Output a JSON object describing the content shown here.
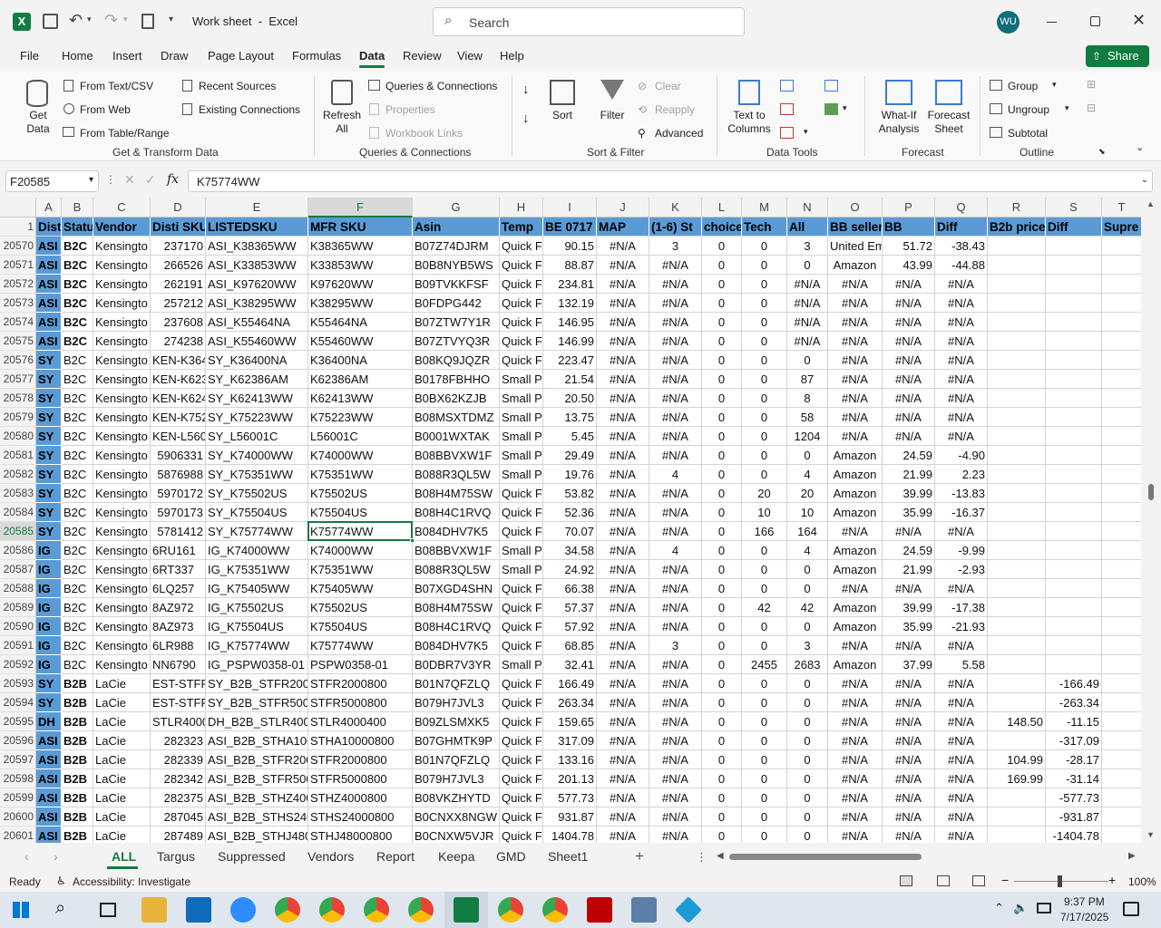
{
  "titlebar": {
    "doc_title": "Work sheet  -  Excel",
    "search_placeholder": "Search",
    "user_initials": "WU"
  },
  "tabs": [
    "File",
    "Home",
    "Insert",
    "Draw",
    "Page Layout",
    "Formulas",
    "Data",
    "Review",
    "View",
    "Help"
  ],
  "active_tab": "Data",
  "share_label": "Share",
  "ribbon": {
    "get_data": "Get Data",
    "from_text_csv": "From Text/CSV",
    "from_web": "From Web",
    "from_table": "From Table/Range",
    "recent_sources": "Recent Sources",
    "existing_connections": "Existing Connections",
    "group_get_transform": "Get & Transform Data",
    "refresh_all": "Refresh All",
    "queries_connections": "Queries & Connections",
    "properties": "Properties",
    "workbook_links": "Workbook Links",
    "group_queries": "Queries & Connections",
    "sort": "Sort",
    "filter": "Filter",
    "clear": "Clear",
    "reapply": "Reapply",
    "advanced": "Advanced",
    "group_sort_filter": "Sort & Filter",
    "text_to_columns": "Text to Columns",
    "group_data_tools": "Data Tools",
    "what_if": "What-If Analysis",
    "forecast_sheet": "Forecast Sheet",
    "group_forecast": "Forecast",
    "group": "Group",
    "ungroup": "Ungroup",
    "subtotal": "Subtotal",
    "group_outline": "Outline"
  },
  "formula_bar": {
    "name_box": "F20585",
    "fx": "fx",
    "value": "K75774WW"
  },
  "columns": [
    "A",
    "B",
    "C",
    "D",
    "E",
    "F",
    "G",
    "H",
    "I",
    "J",
    "K",
    "L",
    "M",
    "N",
    "O",
    "P",
    "Q",
    "R",
    "S",
    "T"
  ],
  "header_row_num": "1",
  "headers": [
    "Dist",
    "Statu",
    "Vendor",
    "Disti SKU",
    "LISTEDSKU",
    "MFR SKU",
    "Asin",
    "Temp",
    "BE 0717",
    "MAP",
    "(1-6) St",
    "choice",
    "Tech",
    "All",
    "BB sellers",
    "BB",
    "Diff",
    "B2b price",
    "Diff",
    "Supre"
  ],
  "rows": [
    {
      "n": "20570",
      "c": [
        "ASI",
        "B2C",
        "Kensingto",
        "237170",
        "ASI_K38365WW",
        "K38365WW",
        "B07Z74DJRM",
        "Quick F",
        "90.15",
        "#N/A",
        "3",
        "0",
        "0",
        "3",
        "United Em",
        "51.72",
        "-38.43",
        "",
        ""
      ]
    },
    {
      "n": "20571",
      "c": [
        "ASI",
        "B2C",
        "Kensingto",
        "266526",
        "ASI_K33853WW",
        "K33853WW",
        "B0B8NYB5WS",
        "Quick F",
        "88.87",
        "#N/A",
        "#N/A",
        "0",
        "0",
        "0",
        "Amazon",
        "43.99",
        "-44.88",
        "",
        ""
      ]
    },
    {
      "n": "20572",
      "c": [
        "ASI",
        "B2C",
        "Kensingto",
        "262191",
        "ASI_K97620WW",
        "K97620WW",
        "B09TVKKFSF",
        "Quick F",
        "234.81",
        "#N/A",
        "#N/A",
        "0",
        "0",
        "#N/A",
        "#N/A",
        "#N/A",
        "#N/A",
        "",
        ""
      ]
    },
    {
      "n": "20573",
      "c": [
        "ASI",
        "B2C",
        "Kensingto",
        "257212",
        "ASI_K38295WW",
        "K38295WW",
        "B0FDPG442",
        "Quick F",
        "132.19",
        "#N/A",
        "#N/A",
        "0",
        "0",
        "#N/A",
        "#N/A",
        "#N/A",
        "#N/A",
        "",
        ""
      ]
    },
    {
      "n": "20574",
      "c": [
        "ASI",
        "B2C",
        "Kensingto",
        "237608",
        "ASI_K55464NA",
        "K55464NA",
        "B07ZTW7Y1R",
        "Quick F",
        "146.95",
        "#N/A",
        "#N/A",
        "0",
        "0",
        "#N/A",
        "#N/A",
        "#N/A",
        "#N/A",
        "",
        ""
      ]
    },
    {
      "n": "20575",
      "c": [
        "ASI",
        "B2C",
        "Kensingto",
        "274238",
        "ASI_K55460WW",
        "K55460WW",
        "B07ZTVYQ3R",
        "Quick F",
        "146.99",
        "#N/A",
        "#N/A",
        "0",
        "0",
        "#N/A",
        "#N/A",
        "#N/A",
        "#N/A",
        "",
        ""
      ]
    },
    {
      "n": "20576",
      "c": [
        "SY",
        "B2C",
        "Kensingto",
        "KEN-K364",
        "SY_K36400NA",
        "K36400NA",
        "B08KQ9JQZR",
        "Quick F",
        "223.47",
        "#N/A",
        "#N/A",
        "0",
        "0",
        "0",
        "#N/A",
        "#N/A",
        "#N/A",
        "",
        ""
      ]
    },
    {
      "n": "20577",
      "c": [
        "SY",
        "B2C",
        "Kensingto",
        "KEN-K623",
        "SY_K62386AM",
        "K62386AM",
        "B0178FBHHO",
        "Small P",
        "21.54",
        "#N/A",
        "#N/A",
        "0",
        "0",
        "87",
        "#N/A",
        "#N/A",
        "#N/A",
        "",
        ""
      ]
    },
    {
      "n": "20578",
      "c": [
        "SY",
        "B2C",
        "Kensingto",
        "KEN-K624",
        "SY_K62413WW",
        "K62413WW",
        "B0BX62KZJB",
        "Small P",
        "20.50",
        "#N/A",
        "#N/A",
        "0",
        "0",
        "8",
        "#N/A",
        "#N/A",
        "#N/A",
        "",
        ""
      ]
    },
    {
      "n": "20579",
      "c": [
        "SY",
        "B2C",
        "Kensingto",
        "KEN-K752",
        "SY_K75223WW",
        "K75223WW",
        "B08MSXTDMZ",
        "Small P",
        "13.75",
        "#N/A",
        "#N/A",
        "0",
        "0",
        "58",
        "#N/A",
        "#N/A",
        "#N/A",
        "",
        ""
      ]
    },
    {
      "n": "20580",
      "c": [
        "SY",
        "B2C",
        "Kensingto",
        "KEN-L5600",
        "SY_L56001C",
        "L56001C",
        "B0001WXTAK",
        "Small P",
        "5.45",
        "#N/A",
        "#N/A",
        "0",
        "0",
        "1204",
        "#N/A",
        "#N/A",
        "#N/A",
        "",
        ""
      ]
    },
    {
      "n": "20581",
      "c": [
        "SY",
        "B2C",
        "Kensingto",
        "5906331",
        "SY_K74000WW",
        "K74000WW",
        "B08BBVXW1F",
        "Small P",
        "29.49",
        "#N/A",
        "#N/A",
        "0",
        "0",
        "0",
        "Amazon",
        "24.59",
        "-4.90",
        "",
        ""
      ]
    },
    {
      "n": "20582",
      "c": [
        "SY",
        "B2C",
        "Kensingto",
        "5876988",
        "SY_K75351WW",
        "K75351WW",
        "B088R3QL5W",
        "Small P",
        "19.76",
        "#N/A",
        "4",
        "0",
        "0",
        "4",
        "Amazon",
        "21.99",
        "2.23",
        "",
        ""
      ]
    },
    {
      "n": "20583",
      "c": [
        "SY",
        "B2C",
        "Kensingto",
        "5970172",
        "SY_K75502US",
        "K75502US",
        "B08H4M75SW",
        "Quick F",
        "53.82",
        "#N/A",
        "#N/A",
        "0",
        "20",
        "20",
        "Amazon",
        "39.99",
        "-13.83",
        "",
        ""
      ]
    },
    {
      "n": "20584",
      "c": [
        "SY",
        "B2C",
        "Kensingto",
        "5970173",
        "SY_K75504US",
        "K75504US",
        "B08H4C1RVQ",
        "Quick F",
        "52.36",
        "#N/A",
        "#N/A",
        "0",
        "10",
        "10",
        "Amazon",
        "35.99",
        "-16.37",
        "",
        ""
      ]
    },
    {
      "n": "20585",
      "c": [
        "SY",
        "B2C",
        "Kensingto",
        "5781412",
        "SY_K75774WW",
        "K75774WW",
        "B084DHV7K5",
        "Quick F",
        "70.07",
        "#N/A",
        "#N/A",
        "0",
        "166",
        "164",
        "#N/A",
        "#N/A",
        "#N/A",
        "",
        ""
      ]
    },
    {
      "n": "20586",
      "c": [
        "IG",
        "B2C",
        "Kensingto",
        "6RU161",
        "IG_K74000WW",
        "K74000WW",
        "B08BBVXW1F",
        "Small P",
        "34.58",
        "#N/A",
        "4",
        "0",
        "0",
        "4",
        "Amazon",
        "24.59",
        "-9.99",
        "",
        ""
      ]
    },
    {
      "n": "20587",
      "c": [
        "IG",
        "B2C",
        "Kensingto",
        "6RT337",
        "IG_K75351WW",
        "K75351WW",
        "B088R3QL5W",
        "Small P",
        "24.92",
        "#N/A",
        "#N/A",
        "0",
        "0",
        "0",
        "Amazon",
        "21.99",
        "-2.93",
        "",
        ""
      ]
    },
    {
      "n": "20588",
      "c": [
        "IG",
        "B2C",
        "Kensingto",
        "6LQ257",
        "IG_K75405WW",
        "K75405WW",
        "B07XGD4SHN",
        "Quick F",
        "66.38",
        "#N/A",
        "#N/A",
        "0",
        "0",
        "0",
        "#N/A",
        "#N/A",
        "#N/A",
        "",
        ""
      ]
    },
    {
      "n": "20589",
      "c": [
        "IG",
        "B2C",
        "Kensingto",
        "8AZ972",
        "IG_K75502US",
        "K75502US",
        "B08H4M75SW",
        "Quick F",
        "57.37",
        "#N/A",
        "#N/A",
        "0",
        "42",
        "42",
        "Amazon",
        "39.99",
        "-17.38",
        "",
        ""
      ]
    },
    {
      "n": "20590",
      "c": [
        "IG",
        "B2C",
        "Kensingto",
        "8AZ973",
        "IG_K75504US",
        "K75504US",
        "B08H4C1RVQ",
        "Quick F",
        "57.92",
        "#N/A",
        "#N/A",
        "0",
        "0",
        "0",
        "Amazon",
        "35.99",
        "-21.93",
        "",
        ""
      ]
    },
    {
      "n": "20591",
      "c": [
        "IG",
        "B2C",
        "Kensingto",
        "6LR988",
        "IG_K75774WW",
        "K75774WW",
        "B084DHV7K5",
        "Quick F",
        "68.85",
        "#N/A",
        "3",
        "0",
        "0",
        "3",
        "#N/A",
        "#N/A",
        "#N/A",
        "",
        ""
      ]
    },
    {
      "n": "20592",
      "c": [
        "IG",
        "B2C",
        "Kensingto",
        "NN6790",
        "IG_PSPW0358-01",
        "PSPW0358-01",
        "B0DBR7V3YR",
        "Small P",
        "32.41",
        "#N/A",
        "#N/A",
        "0",
        "2455",
        "2683",
        "Amazon",
        "37.99",
        "5.58",
        "",
        ""
      ]
    },
    {
      "n": "20593",
      "c": [
        "SY",
        "B2B",
        "LaCie",
        "EST-STFR2",
        "SY_B2B_STFR2000800",
        "STFR2000800",
        "B01N7QFZLQ",
        "Quick F",
        "166.49",
        "#N/A",
        "#N/A",
        "0",
        "0",
        "0",
        "#N/A",
        "#N/A",
        "#N/A",
        "",
        "-166.49"
      ]
    },
    {
      "n": "20594",
      "c": [
        "SY",
        "B2B",
        "LaCie",
        "EST-STFR5",
        "SY_B2B_STFR5000800",
        "STFR5000800",
        "B079H7JVL3",
        "Quick F",
        "263.34",
        "#N/A",
        "#N/A",
        "0",
        "0",
        "0",
        "#N/A",
        "#N/A",
        "#N/A",
        "",
        "-263.34"
      ]
    },
    {
      "n": "20595",
      "c": [
        "DH",
        "B2B",
        "LaCie",
        "STLR40004",
        "DH_B2B_STLR4000400",
        "STLR4000400",
        "B09ZLSMXK5",
        "Quick F",
        "159.65",
        "#N/A",
        "#N/A",
        "0",
        "0",
        "0",
        "#N/A",
        "#N/A",
        "#N/A",
        "148.50",
        "-11.15"
      ]
    },
    {
      "n": "20596",
      "c": [
        "ASI",
        "B2B",
        "LaCie",
        "282323",
        "ASI_B2B_STHA10000800",
        "STHA10000800",
        "B07GHMTK9P",
        "Quick F",
        "317.09",
        "#N/A",
        "#N/A",
        "0",
        "0",
        "0",
        "#N/A",
        "#N/A",
        "#N/A",
        "",
        "-317.09"
      ]
    },
    {
      "n": "20597",
      "c": [
        "ASI",
        "B2B",
        "LaCie",
        "282339",
        "ASI_B2B_STFR2000800",
        "STFR2000800",
        "B01N7QFZLQ",
        "Quick F",
        "133.16",
        "#N/A",
        "#N/A",
        "0",
        "0",
        "0",
        "#N/A",
        "#N/A",
        "#N/A",
        "104.99",
        "-28.17"
      ]
    },
    {
      "n": "20598",
      "c": [
        "ASI",
        "B2B",
        "LaCie",
        "282342",
        "ASI_B2B_STFR5000800",
        "STFR5000800",
        "B079H7JVL3",
        "Quick F",
        "201.13",
        "#N/A",
        "#N/A",
        "0",
        "0",
        "0",
        "#N/A",
        "#N/A",
        "#N/A",
        "169.99",
        "-31.14"
      ]
    },
    {
      "n": "20599",
      "c": [
        "ASI",
        "B2B",
        "LaCie",
        "282375",
        "ASI_B2B_STHZ4000800",
        "STHZ4000800",
        "B08VKZHYTD",
        "Quick F",
        "577.73",
        "#N/A",
        "#N/A",
        "0",
        "0",
        "0",
        "#N/A",
        "#N/A",
        "#N/A",
        "",
        "-577.73"
      ]
    },
    {
      "n": "20600",
      "c": [
        "ASI",
        "B2B",
        "LaCie",
        "287045",
        "ASI_B2B_STHS24000800",
        "STHS24000800",
        "B0CNXX8NGW",
        "Quick F",
        "931.87",
        "#N/A",
        "#N/A",
        "0",
        "0",
        "0",
        "#N/A",
        "#N/A",
        "#N/A",
        "",
        "-931.87"
      ]
    },
    {
      "n": "20601",
      "c": [
        "ASI",
        "B2B",
        "LaCie",
        "287489",
        "ASI_B2B_STHJ48000800",
        "STHJ48000800",
        "B0CNXW5VJR",
        "Quick F",
        "1404.78",
        "#N/A",
        "#N/A",
        "0",
        "0",
        "0",
        "#N/A",
        "#N/A",
        "#N/A",
        "",
        "-1404.78"
      ]
    }
  ],
  "selected_row": "20585",
  "sheets": [
    "ALL",
    "Targus",
    "Suppressed",
    "Vendors",
    "Report",
    "Keepa",
    "GMD",
    "Sheet1"
  ],
  "active_sheet": "ALL",
  "status": {
    "ready": "Ready",
    "accessibility": "Accessibility: Investigate",
    "zoom": "100%"
  },
  "taskbar": {
    "time": "9:37 PM",
    "date": "7/17/2025"
  },
  "colors": {
    "excel_green": "#107c41",
    "header_blue": "#5b9bd5"
  }
}
